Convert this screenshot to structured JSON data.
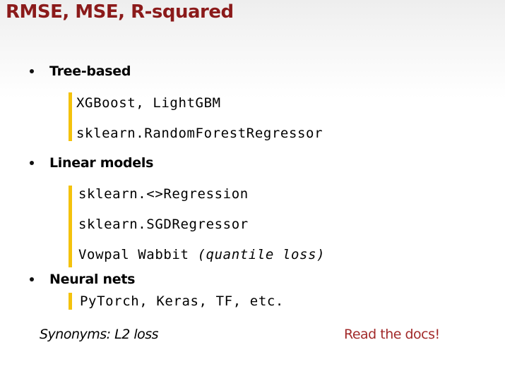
{
  "title": "RMSE, MSE, R-squared",
  "sections": [
    {
      "heading": "Tree-based",
      "items": [
        "XGBoost, LightGBM",
        "sklearn.RandomForestRegressor"
      ]
    },
    {
      "heading": "Linear models",
      "items": [
        "sklearn.<>Regression",
        "sklearn.SGDRegressor",
        "Vowpal Wabbit",
        "(quantile loss)"
      ]
    },
    {
      "heading": "Neural nets",
      "items": [
        "PyTorch, Keras, TF, etc."
      ]
    }
  ],
  "footer": {
    "synonyms": "Synonyms: L2 loss",
    "read_docs": "Read the docs!"
  },
  "colors": {
    "title": "#8b1a1a",
    "accent_bar": "#f4c20d",
    "read_docs": "#a22a2a"
  }
}
